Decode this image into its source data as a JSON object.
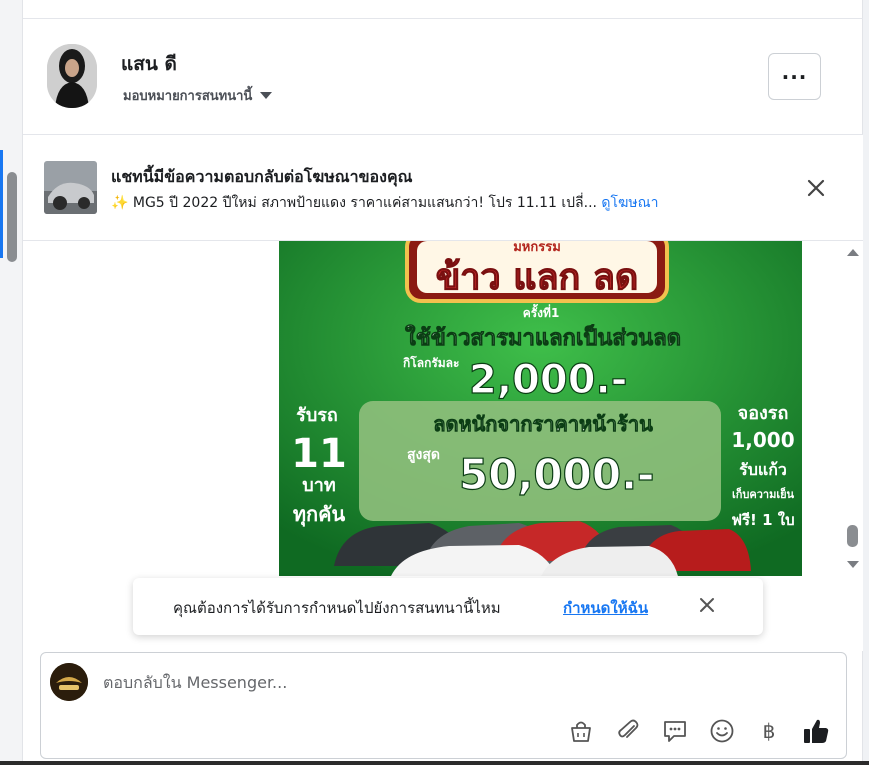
{
  "header": {
    "name": "แสน ดี",
    "assign_label": "มอบหมายการสนทนานี้"
  },
  "ad_notice": {
    "title": "แชทนี้มีข้อความตอบกลับต่อโฆษณาของคุณ",
    "snippet": "✨ MG5 ปี 2022 ปีใหม่ สภาพป้ายแดง ราคาแค่สามแสนกว่า! โปร 11.11 เปลี่...",
    "link": "ดูโฆษณา"
  },
  "ad_image": {
    "event_small": "มหกรรม",
    "event_big": "ข้าว แลก ลด",
    "times": "ครั้งที่1",
    "rice_line": "ใช้ข้าวสารมาแลกเป็นส่วนลด",
    "per_kg": "กิโลกรัมละ",
    "per_kg_amount": "2,000.-",
    "discount_line": "ลดหนักจากราคาหน้าร้าน",
    "max_label": "สูงสุด",
    "max_amount": "50,000.-",
    "left_1": "รับรถ",
    "left_2": "11",
    "left_3": "บาท",
    "left_4": "ทุกคัน",
    "right_1": "จองรถ",
    "right_2": "1,000",
    "right_3": "รับแก้ว",
    "right_4": "เก็บความเย็น",
    "right_5": "ฟรี! 1 ใบ"
  },
  "assign_prompt": {
    "text": "คุณต้องการได้รับการกำหนดไปยังการสนทนานี้ไหม",
    "link": "กำหนดให้ฉัน"
  },
  "composer": {
    "placeholder": "ตอบกลับใน Messenger..."
  },
  "icons": [
    "more-icon",
    "caret-down-icon",
    "close-icon",
    "shopping-bag-icon",
    "attachment-icon",
    "saved-reply-icon",
    "emoji-icon",
    "baht-icon",
    "like-icon"
  ],
  "colors": {
    "accent": "#1877f2",
    "ad_green": "#1f8a2e"
  }
}
